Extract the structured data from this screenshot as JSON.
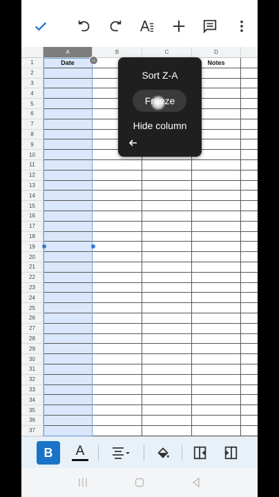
{
  "toolbar": {
    "icons": [
      "check-icon",
      "undo-icon",
      "redo-icon",
      "text-format-icon",
      "insert-icon",
      "comment-icon",
      "more-icon"
    ]
  },
  "sheet": {
    "column_headers": [
      "A",
      "B",
      "C",
      "D"
    ],
    "row_numbers": [
      "1",
      "2",
      "3",
      "4",
      "5",
      "6",
      "7",
      "8",
      "9",
      "10",
      "11",
      "12",
      "13",
      "14",
      "15",
      "16",
      "17",
      "18",
      "19",
      "20",
      "21",
      "22",
      "23",
      "24",
      "25",
      "26",
      "27",
      "28",
      "29",
      "30",
      "31",
      "32",
      "33",
      "34",
      "35",
      "36",
      "37"
    ],
    "row1": {
      "A": "Date",
      "B": "",
      "C": "",
      "D": "Notes"
    }
  },
  "context_menu": {
    "items": [
      "Sort Z-A",
      "Freeze",
      "Hide column"
    ]
  },
  "format_bar": {
    "bold_label": "B",
    "text_color_label": "A"
  },
  "colors": {
    "accent": "#1a73c6",
    "selection_fill": "#dbe8fb",
    "menu_bg": "#1f1f1f"
  }
}
